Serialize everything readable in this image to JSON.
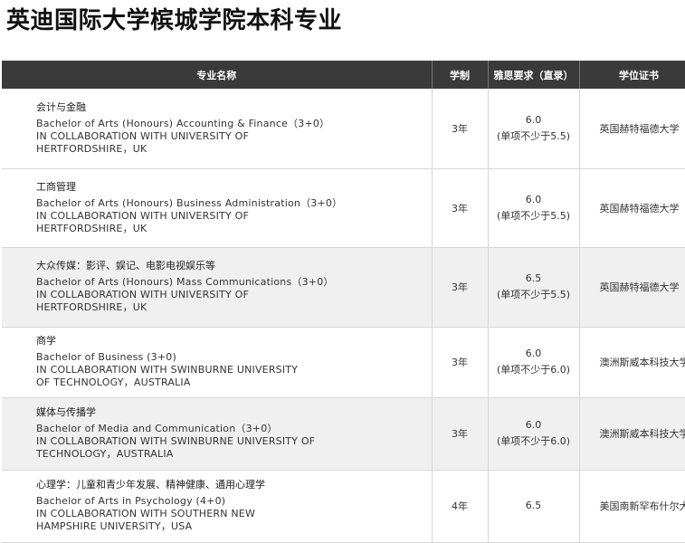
{
  "page": {
    "title": "英迪国际大学槟城学院本科专业"
  },
  "table": {
    "headers": [
      "专业名称",
      "学制",
      "雅思要求（直录）",
      "学位证书"
    ],
    "rows": [
      {
        "name_zh": "会计与金融",
        "name_en": [
          "Bachelor of Arts (Honours) Accounting & Finance（3+0）",
          "IN COLLABORATION WITH UNIVERSITY OF",
          "HERTFORDSHIRE，UK"
        ],
        "duration": "3年",
        "ielts_score": "6.0",
        "ielts_note": "(单项不少于5.5)",
        "degree": "英国赫特福德大学"
      },
      {
        "name_zh": "工商管理",
        "name_en": [
          "Bachelor of Arts (Honours) Business Administration（3+0）",
          "IN COLLABORATION WITH UNIVERSITY OF",
          "HERTFORDSHIRE，UK"
        ],
        "duration": "3年",
        "ielts_score": "6.0",
        "ielts_note": "(单项不少于5.5)",
        "degree": "英国赫特福德大学"
      },
      {
        "name_zh": "大众传媒：影评、娱记、电影电视娱乐等",
        "name_en": [
          "Bachelor of Arts (Honours) Mass Communications（3+0）",
          "IN COLLABORATION WITH UNIVERSITY OF",
          "HERTFORDSHIRE，UK"
        ],
        "duration": "3年",
        "ielts_score": "6.5",
        "ielts_note": "(单项不少于5.5)",
        "degree": "英国赫特福德大学"
      },
      {
        "name_zh": "商学",
        "name_en": [
          "Bachelor of Business (3+0)",
          "IN COLLABORATION WITH SWINBURNE UNIVERSITY",
          "OF TECHNOLOGY，AUSTRALIA"
        ],
        "duration": "3年",
        "ielts_score": "6.0",
        "ielts_note": "(单项不少于6.0)",
        "degree": "澳洲斯威本科技大学"
      },
      {
        "name_zh": "媒体与传播学",
        "name_en": [
          "Bachelor of Media and Communication（3+0）",
          "IN COLLABORATION WITH SWINBURNE UNIVERSITY OF",
          "TECHNOLOGY，AUSTRALIA"
        ],
        "duration": "3年",
        "ielts_score": "6.0",
        "ielts_note": "(单项不少于6.0)",
        "degree": "澳洲斯威本科技大学"
      },
      {
        "name_zh": "心理学：儿童和青少年发展、精神健康、通用心理学",
        "name_en": [
          "Bachelor of Arts in Psychology (4+0)",
          "IN COLLABORATION WITH SOUTHERN NEW",
          "HAMPSHIRE UNIVERSITY，USA"
        ],
        "duration": "4年",
        "ielts_score": "6.5",
        "ielts_note": "",
        "degree": "美国南新罕布什尔大学"
      }
    ]
  },
  "colors": {
    "header_bg": "#3a3a3a",
    "header_text": "#ffffff",
    "row_shade": "#f0f0f0",
    "border": "#d6d6d6"
  }
}
